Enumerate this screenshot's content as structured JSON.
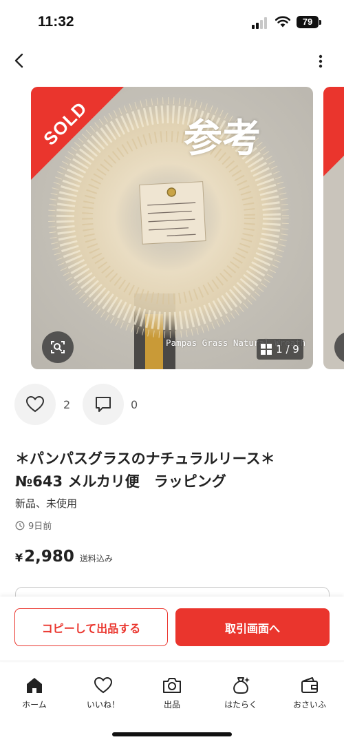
{
  "status": {
    "time": "11:32",
    "battery": "79"
  },
  "nav": {
    "back_icon": "chevron-left-icon",
    "more_icon": "more-vertical-icon"
  },
  "gallery": {
    "sold_label": "SOLD",
    "reference_label": "参考",
    "watermark": "Pampas Grass Natural Wreath",
    "counter": "1 / 9"
  },
  "actions": {
    "like_count": "2",
    "comment_count": "0"
  },
  "item": {
    "title_line1": "＊パンパスグラスのナチュラルリース＊",
    "title_line2": "№643 メルカリ便　ラッピング",
    "condition": "新品、未使用",
    "posted": "9日前",
    "currency": "¥",
    "price": "2,980",
    "shipping_note": "送料込み"
  },
  "buttons": {
    "copy": "コピーして出品する",
    "trade": "取引画面へ"
  },
  "tabs": [
    {
      "label": "ホーム",
      "icon": "home-icon"
    },
    {
      "label": "いいね！",
      "icon": "heart-icon"
    },
    {
      "label": "出品",
      "icon": "camera-icon"
    },
    {
      "label": "はたらく",
      "icon": "money-bag-icon"
    },
    {
      "label": "おさいふ",
      "icon": "wallet-icon"
    }
  ],
  "colors": {
    "accent": "#ea352d"
  }
}
